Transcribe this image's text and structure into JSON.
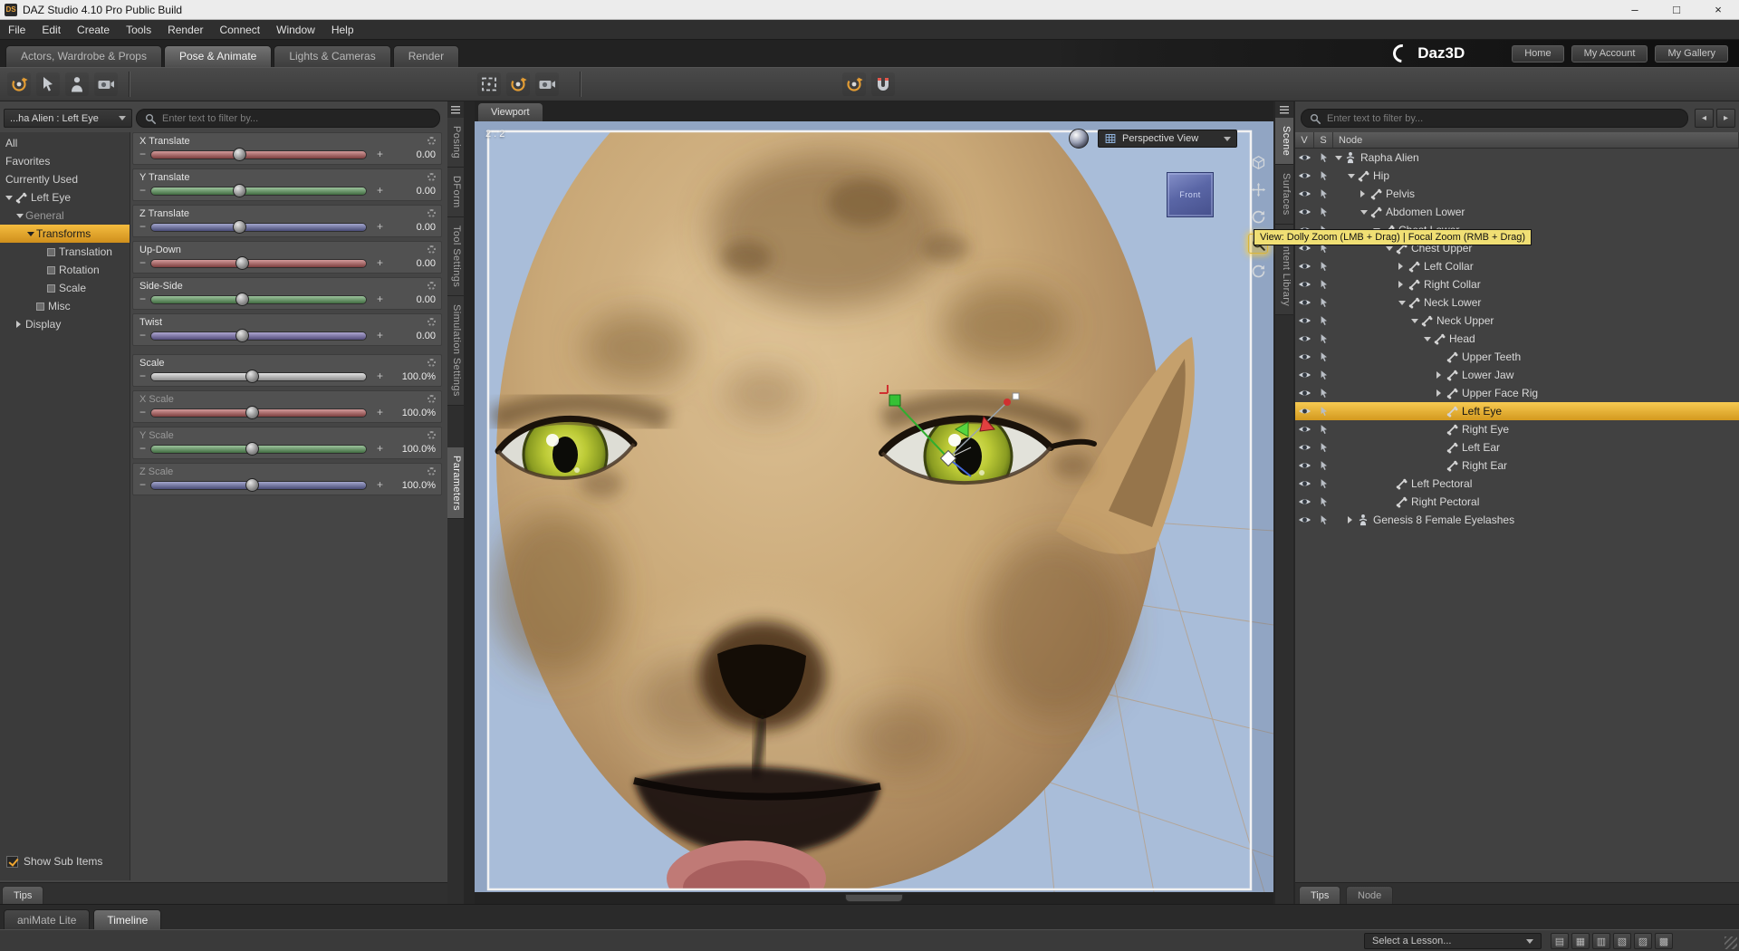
{
  "window": {
    "app_icon": "DS",
    "title": "DAZ Studio 4.10 Pro Public Build",
    "controls": {
      "minimize": "–",
      "maximize": "□",
      "close": "×"
    }
  },
  "menubar": [
    "File",
    "Edit",
    "Create",
    "Tools",
    "Render",
    "Connect",
    "Window",
    "Help"
  ],
  "activity_tabs": [
    {
      "label": "Actors, Wardrobe & Props",
      "active": false
    },
    {
      "label": "Pose & Animate",
      "active": true
    },
    {
      "label": "Lights & Cameras",
      "active": false
    },
    {
      "label": "Render",
      "active": false
    }
  ],
  "brand": {
    "logo": "Daz3D",
    "links": [
      "Home",
      "My Account",
      "My Gallery"
    ]
  },
  "toolbar": {
    "groups": [
      [
        "pose-rotate-tool",
        "pointer-tool",
        "figure-tool",
        "camera-tool"
      ],
      [
        "frame-tool",
        "pose-rotate-tool",
        "render-camera-tool"
      ],
      [
        "pose-rotate-tool",
        "magnet-tool"
      ]
    ]
  },
  "parameters_panel": {
    "node_selector": {
      "value": "...ha Alien : Left Eye"
    },
    "filter": {
      "placeholder": "Enter text to filter by..."
    },
    "nav_items": [
      {
        "label": "All",
        "type": "plain",
        "level": 0
      },
      {
        "label": "Favorites",
        "type": "plain",
        "level": 0
      },
      {
        "label": "Currently Used",
        "type": "plain",
        "level": 0
      },
      {
        "label": "Left Eye",
        "type": "node",
        "level": 0,
        "exp": "open",
        "icon": "bone"
      },
      {
        "label": "General",
        "type": "group",
        "level": 1,
        "exp": "open",
        "dim": true
      },
      {
        "label": "Transforms",
        "type": "group",
        "level": 2,
        "exp": "open",
        "selected": true
      },
      {
        "label": "Translation",
        "type": "leaf",
        "level": 3,
        "icon": "sq"
      },
      {
        "label": "Rotation",
        "type": "leaf",
        "level": 3,
        "icon": "sq"
      },
      {
        "label": "Scale",
        "type": "leaf",
        "level": 3,
        "icon": "sq"
      },
      {
        "label": "Misc",
        "type": "leaf",
        "level": 2,
        "icon": "sq"
      },
      {
        "label": "Display",
        "type": "group",
        "level": 1,
        "exp": "closed"
      }
    ],
    "sliders": [
      {
        "label": "X Translate",
        "value": "0.00",
        "color": "#b85c5c",
        "pos": 41
      },
      {
        "label": "Y Translate",
        "value": "0.00",
        "color": "#5f9e5f",
        "pos": 41
      },
      {
        "label": "Z Translate",
        "value": "0.00",
        "color": "#6a6fae",
        "pos": 41
      },
      {
        "label": "Up-Down",
        "value": "0.00",
        "color": "#b85c5c",
        "pos": 42
      },
      {
        "label": "Side-Side",
        "value": "0.00",
        "color": "#5f9e5f",
        "pos": 42
      },
      {
        "label": "Twist",
        "value": "0.00",
        "color": "#7a6fb4",
        "pos": 42
      },
      {
        "label": "Scale",
        "value": "100.0%",
        "color": "#cfcfcf",
        "pos": 47,
        "gap": true
      },
      {
        "label": "X Scale",
        "value": "100.0%",
        "color": "#b85c5c",
        "pos": 47,
        "dim": true
      },
      {
        "label": "Y Scale",
        "value": "100.0%",
        "color": "#5f9e5f",
        "pos": 47,
        "dim": true
      },
      {
        "label": "Z Scale",
        "value": "100.0%",
        "color": "#6a6fae",
        "pos": 47,
        "dim": true
      }
    ],
    "show_sub_items": "Show Sub Items",
    "footer_tab": "Tips",
    "side_tabs": [
      {
        "label": "Posing"
      },
      {
        "label": "DForm"
      },
      {
        "label": "Tool Settings"
      },
      {
        "label": "Simulation Settings"
      },
      {
        "label": "Parameters",
        "active": true,
        "gap": true
      }
    ]
  },
  "viewport": {
    "tab": "Viewport",
    "ratio_label": "2 : 2",
    "camera_select": {
      "value": "Perspective View"
    },
    "nav_cube_label": "Front",
    "tools": [
      {
        "name": "frame-view"
      },
      {
        "name": "pan-view"
      },
      {
        "name": "rotate-view"
      },
      {
        "name": "dolly-zoom",
        "active": true
      },
      {
        "name": "orbit-view"
      }
    ],
    "tooltip": "View: Dolly Zoom (LMB + Drag) | Focal Zoom (RMB + Drag)"
  },
  "scene_panel": {
    "filter": {
      "placeholder": "Enter text to filter by..."
    },
    "header_buttons": [
      {
        "glyph": "◂",
        "name": "back-button"
      },
      {
        "glyph": "▸",
        "name": "forward-button"
      }
    ],
    "columns": [
      "V",
      "S",
      "Node"
    ],
    "side_tabs": [
      {
        "label": "Scene",
        "active": true
      },
      {
        "label": "Surfaces"
      },
      {
        "label": "Content Library"
      }
    ],
    "tree": [
      {
        "label": "Rapha Alien",
        "level": 0,
        "exp": "open",
        "icon": "figure"
      },
      {
        "label": "Hip",
        "level": 1,
        "exp": "open",
        "icon": "bone"
      },
      {
        "label": "Pelvis",
        "level": 2,
        "exp": "closed",
        "icon": "bone"
      },
      {
        "label": "Abdomen Lower",
        "level": 2,
        "exp": "open",
        "icon": "bone"
      },
      {
        "label": "Chest Lower",
        "level": 3,
        "exp": "open",
        "icon": "bone"
      },
      {
        "label": "Chest Upper",
        "level": 4,
        "exp": "open",
        "icon": "bone"
      },
      {
        "label": "Left Collar",
        "level": 5,
        "exp": "closed",
        "icon": "bone"
      },
      {
        "label": "Right Collar",
        "level": 5,
        "exp": "closed",
        "icon": "bone"
      },
      {
        "label": "Neck Lower",
        "level": 5,
        "exp": "open",
        "icon": "bone"
      },
      {
        "label": "Neck Upper",
        "level": 6,
        "exp": "open",
        "icon": "bone"
      },
      {
        "label": "Head",
        "level": 7,
        "exp": "open",
        "icon": "bone"
      },
      {
        "label": "Upper Teeth",
        "level": 8,
        "icon": "bone"
      },
      {
        "label": "Lower Jaw",
        "level": 8,
        "exp": "closed",
        "icon": "bone"
      },
      {
        "label": "Upper Face Rig",
        "level": 8,
        "exp": "closed",
        "icon": "bone"
      },
      {
        "label": "Left Eye",
        "level": 8,
        "icon": "bone",
        "selected": true
      },
      {
        "label": "Right Eye",
        "level": 8,
        "icon": "bone"
      },
      {
        "label": "Left Ear",
        "level": 8,
        "icon": "bone"
      },
      {
        "label": "Right Ear",
        "level": 8,
        "icon": "bone"
      },
      {
        "label": "Left Pectoral",
        "level": 4,
        "icon": "bone"
      },
      {
        "label": "Right Pectoral",
        "level": 4,
        "icon": "bone"
      },
      {
        "label": "Genesis 8 Female Eyelashes",
        "level": 1,
        "exp": "closed",
        "icon": "figure"
      }
    ],
    "footer_tabs": [
      {
        "label": "Tips",
        "active": true
      },
      {
        "label": "Node"
      }
    ]
  },
  "bottom": {
    "tabs": [
      {
        "label": "aniMate Lite",
        "active": false
      },
      {
        "label": "Timeline",
        "active": true
      }
    ],
    "lesson_select": "Select a Lesson...",
    "status_icons": [
      "▤",
      "▦",
      "▥",
      "▧",
      "▨",
      "▩"
    ]
  },
  "colors": {
    "accent": "#e9a83a",
    "selection": "#f0b33c",
    "viewport_bg": "#a9bdd9",
    "tooltip_bg": "#f0df74"
  }
}
